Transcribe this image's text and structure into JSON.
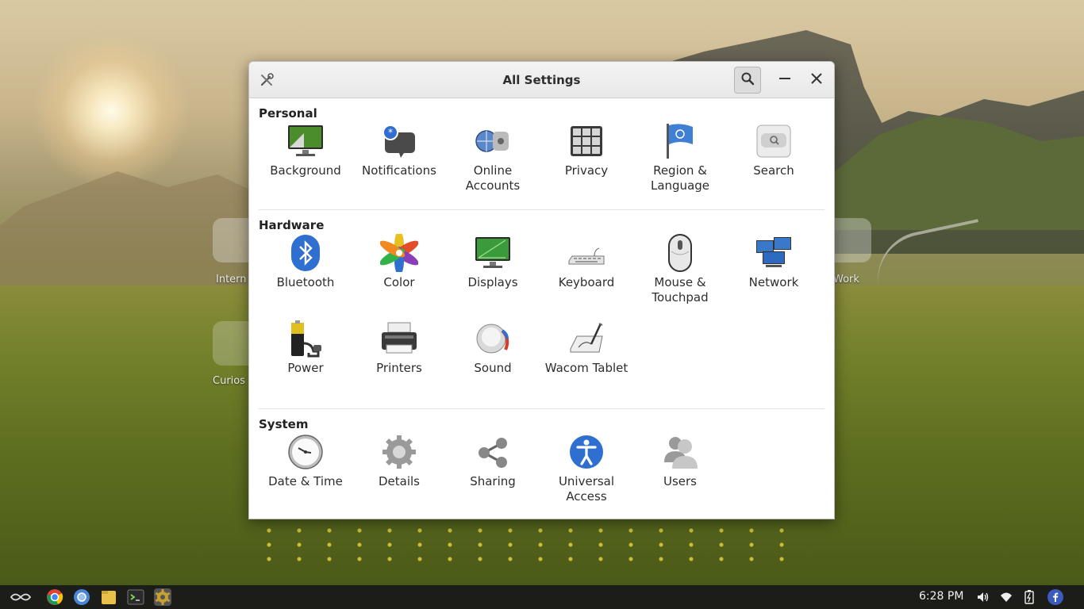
{
  "desktop": {
    "left_icon_label": "Intern",
    "left_icon2_label": "Curios",
    "right_icon_label": "Work"
  },
  "window": {
    "title": "All Settings",
    "app_icon": "settings-tools-icon",
    "buttons": {
      "search": "search-icon",
      "minimize": "minimize-icon",
      "close": "close-icon"
    }
  },
  "sections": {
    "personal": {
      "title": "Personal",
      "items": [
        {
          "label": "Background",
          "icon": "background-icon"
        },
        {
          "label": "Notifications",
          "icon": "notifications-icon"
        },
        {
          "label": "Online Accounts",
          "icon": "online-accounts-icon"
        },
        {
          "label": "Privacy",
          "icon": "privacy-icon"
        },
        {
          "label": "Region & Language",
          "icon": "region-language-icon"
        },
        {
          "label": "Search",
          "icon": "search-settings-icon"
        }
      ]
    },
    "hardware": {
      "title": "Hardware",
      "items": [
        {
          "label": "Bluetooth",
          "icon": "bluetooth-icon"
        },
        {
          "label": "Color",
          "icon": "color-icon"
        },
        {
          "label": "Displays",
          "icon": "displays-icon"
        },
        {
          "label": "Keyboard",
          "icon": "keyboard-icon"
        },
        {
          "label": "Mouse & Touchpad",
          "icon": "mouse-icon"
        },
        {
          "label": "Network",
          "icon": "network-icon"
        },
        {
          "label": "Power",
          "icon": "power-icon"
        },
        {
          "label": "Printers",
          "icon": "printer-icon"
        },
        {
          "label": "Sound",
          "icon": "sound-icon"
        },
        {
          "label": "Wacom Tablet",
          "icon": "wacom-tablet-icon"
        }
      ]
    },
    "system": {
      "title": "System",
      "items": [
        {
          "label": "Date & Time",
          "icon": "clock-icon"
        },
        {
          "label": "Details",
          "icon": "details-gear-icon"
        },
        {
          "label": "Sharing",
          "icon": "sharing-icon"
        },
        {
          "label": "Universal Access",
          "icon": "universal-access-icon"
        },
        {
          "label": "Users",
          "icon": "users-icon"
        }
      ]
    }
  },
  "taskbar": {
    "launcher_icon": "launcher-icon",
    "apps": [
      "chrome-icon",
      "chromium-icon",
      "files-icon",
      "terminal-icon",
      "settings-icon"
    ],
    "clock": "6:28 PM",
    "tray": [
      "volume-icon",
      "wifi-icon",
      "battery-icon",
      "facebook-icon"
    ]
  },
  "colors": {
    "accent_blue": "#2f6fd0",
    "titlebar": "#ececec",
    "taskbar": "#1a1a1a"
  }
}
